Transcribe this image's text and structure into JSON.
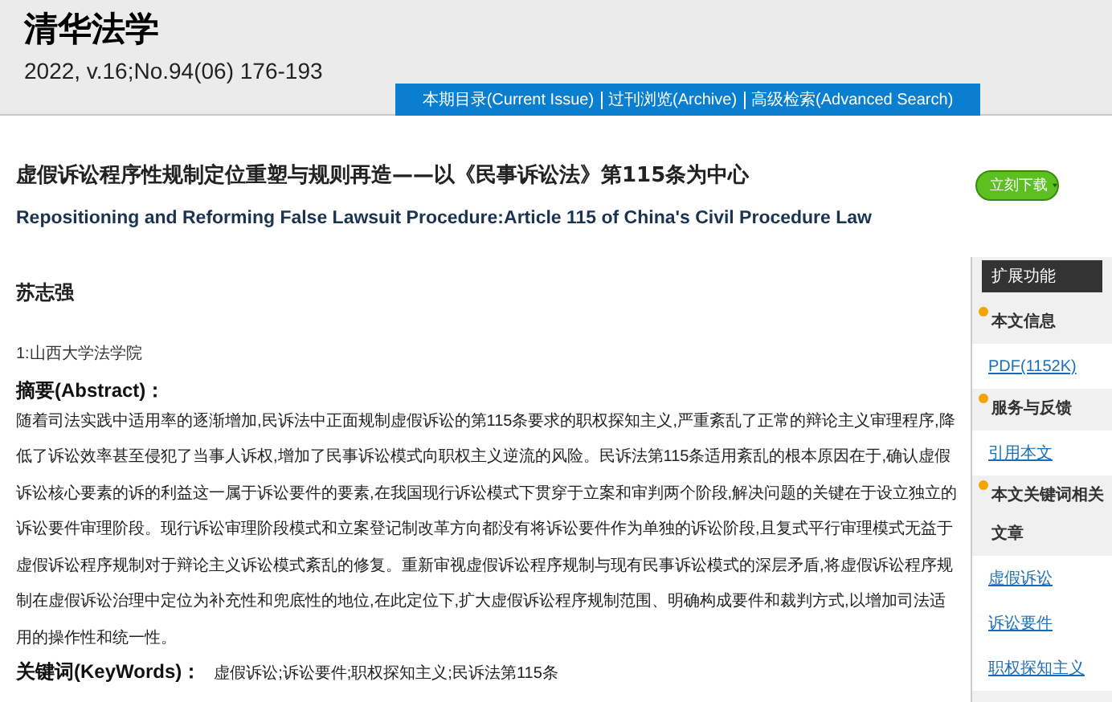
{
  "journal": {
    "title": "清华法学",
    "issue": "2022, v.16;No.94(06) 176-193"
  },
  "nav": [
    "本期目录(Current Issue)",
    "过刊浏览(Archive)",
    "高级检索(Advanced Search)"
  ],
  "article": {
    "title_zh": "虚假诉讼程序性规制定位重塑与规则再造——以《民事诉讼法》第115条为中心",
    "title_en": "Repositioning and Reforming False Lawsuit Procedure:Article 115 of China's Civil Procedure Law",
    "download_button": "立刻下载",
    "author": "苏志强",
    "affiliation": "1:山西大学法学院",
    "abstract_label": "摘要(Abstract)：",
    "abstract": "随着司法实践中适用率的逐渐增加,民诉法中正面规制虚假诉讼的第115条要求的职权探知主义,严重紊乱了正常的辩论主义审理程序,降低了诉讼效率甚至侵犯了当事人诉权,增加了民事诉讼模式向职权主义逆流的风险。民诉法第115条适用紊乱的根本原因在于,确认虚假诉讼核心要素的诉的利益这一属于诉讼要件的要素,在我国现行诉讼模式下贯穿于立案和审判两个阶段,解决问题的关键在于设立独立的诉讼要件审理阶段。现行诉讼审理阶段模式和立案登记制改革方向都没有将诉讼要件作为单独的诉讼阶段,且复式平行审理模式无益于虚假诉讼程序规制对于辩论主义诉讼模式紊乱的修复。重新审视虚假诉讼程序规制与现有民事诉讼模式的深层矛盾,将虚假诉讼程序规制在虚假诉讼治理中定位为补充性和兜底性的地位,在此定位下,扩大虚假诉讼程序规制范围、明确构成要件和裁判方式,以增加司法适用的操作性和统一性。",
    "keywords_label": "关键词(KeyWords)：",
    "keywords": "虚假诉讼;诉讼要件;职权探知主义;民诉法第115条"
  },
  "sidebar": {
    "title": "扩展功能",
    "items": [
      {
        "kind": "heading",
        "text": "本文信息"
      },
      {
        "kind": "link",
        "text": "PDF(1152K)"
      },
      {
        "kind": "heading",
        "text": "服务与反馈"
      },
      {
        "kind": "link",
        "text": "引用本文"
      },
      {
        "kind": "heading",
        "text": "本文关键词相关文章"
      },
      {
        "kind": "link",
        "text": "虚假诉讼"
      },
      {
        "kind": "link",
        "text": "诉讼要件"
      },
      {
        "kind": "link",
        "text": "职权探知主义"
      }
    ]
  }
}
